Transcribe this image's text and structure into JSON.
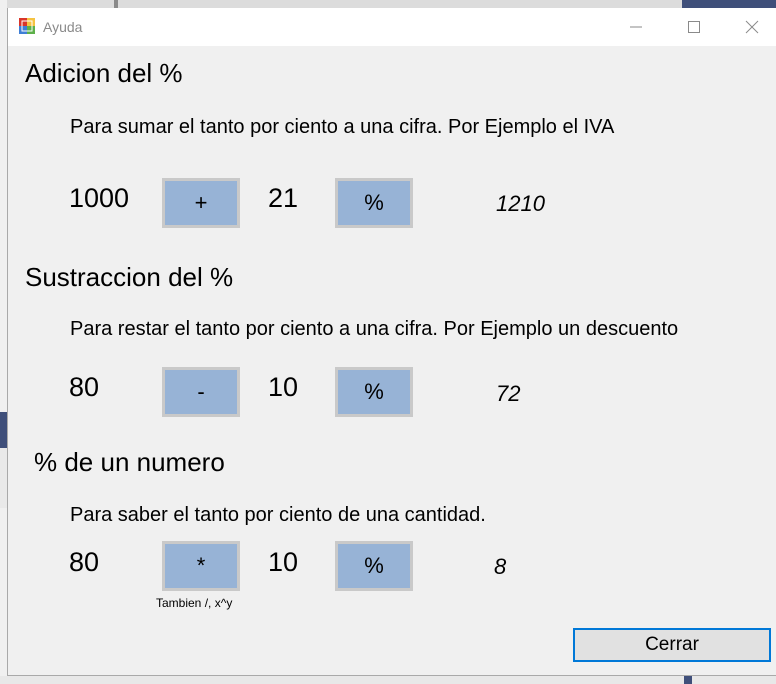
{
  "window": {
    "title": "Ayuda"
  },
  "sections": [
    {
      "heading": "Adicion del %",
      "description": "Para sumar el tanto por ciento a una cifra. Por Ejemplo el IVA",
      "number": "1000",
      "operator": "+",
      "percent": "21",
      "percent_button": "%",
      "result": "1210"
    },
    {
      "heading": "Sustraccion del %",
      "description": "Para restar el tanto por ciento a una cifra. Por Ejemplo un descuento",
      "number": "80",
      "operator": "-",
      "percent": "10",
      "percent_button": "%",
      "result": "72"
    },
    {
      "heading": "% de un numero",
      "description": "Para saber el tanto por ciento de una cantidad.",
      "number": "80",
      "operator": "*",
      "percent": "10",
      "percent_button": "%",
      "result": "8",
      "hint": "Tambien /, x^y"
    }
  ],
  "close_button": "Cerrar",
  "colors": {
    "button_fill": "#97b3d6",
    "button_border": "#c9c9c9",
    "focus_border": "#0078d7"
  }
}
